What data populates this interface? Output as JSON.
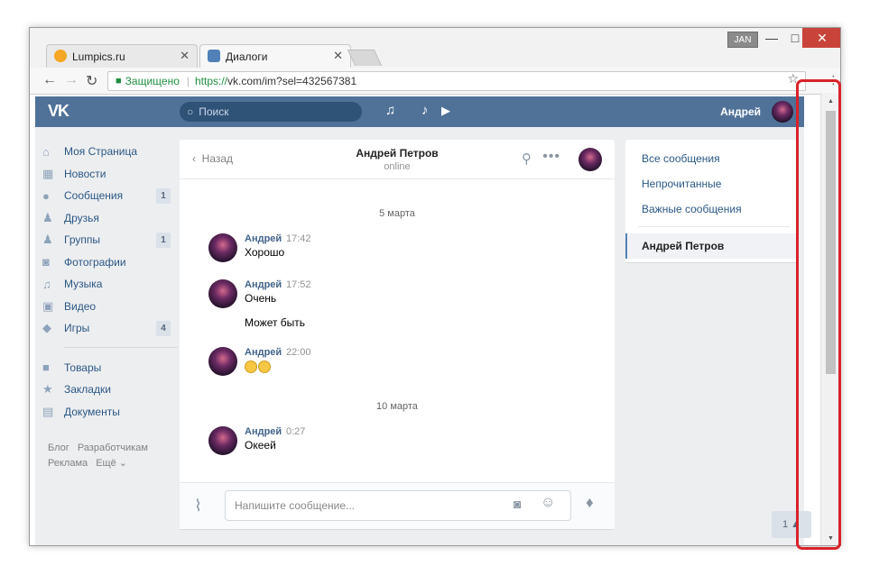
{
  "browser": {
    "tabs": [
      {
        "title": "Lumpics.ru",
        "favicon_color": "#f5a623"
      },
      {
        "title": "Диалоги",
        "favicon_color": "#5181b8"
      }
    ],
    "user_chip": "JAN",
    "window_buttons": {
      "minimize": "—",
      "maximize": "□",
      "close": "✕"
    },
    "nav": {
      "back": "←",
      "forward": "→",
      "reload": "↻"
    },
    "address": {
      "secure_label": "Защищено",
      "scheme": "https://",
      "rest": "vk.com/im?sel=432567381"
    },
    "star": "☆",
    "menu": "⋮"
  },
  "vk_header": {
    "logo": "VK",
    "search_placeholder": "Поиск",
    "user_name": "Андрей",
    "accent_color": "#507299"
  },
  "left_nav": {
    "items": [
      {
        "label": "Моя Страница",
        "icon": "home-icon",
        "glyph": "⌂",
        "badge": ""
      },
      {
        "label": "Новости",
        "icon": "news-icon",
        "glyph": "▦",
        "badge": ""
      },
      {
        "label": "Сообщения",
        "icon": "messages-icon",
        "glyph": "●",
        "badge": "1"
      },
      {
        "label": "Друзья",
        "icon": "friends-icon",
        "glyph": "♟",
        "badge": ""
      },
      {
        "label": "Группы",
        "icon": "groups-icon",
        "glyph": "♟",
        "badge": "1"
      },
      {
        "label": "Фотографии",
        "icon": "photos-icon",
        "glyph": "◙",
        "badge": ""
      },
      {
        "label": "Музыка",
        "icon": "music-icon",
        "glyph": "♫",
        "badge": ""
      },
      {
        "label": "Видео",
        "icon": "video-icon",
        "glyph": "▣",
        "badge": ""
      },
      {
        "label": "Игры",
        "icon": "games-icon",
        "glyph": "◆",
        "badge": "4"
      }
    ],
    "items2": [
      {
        "label": "Товары",
        "icon": "goods-icon",
        "glyph": "■"
      },
      {
        "label": "Закладки",
        "icon": "bookmarks-icon",
        "glyph": "★"
      },
      {
        "label": "Документы",
        "icon": "documents-icon",
        "glyph": "▤"
      }
    ],
    "footer": {
      "blog": "Блог",
      "dev": "Разработчикам",
      "ads": "Реклама",
      "more": "Ещё ⌄"
    }
  },
  "chat": {
    "back_label": "Назад",
    "peer_name": "Андрей Петров",
    "peer_status": "online",
    "dates": [
      "5 марта",
      "10 марта"
    ],
    "messages": [
      {
        "author": "Андрей",
        "time": "17:42",
        "lines": [
          "Хорошо"
        ]
      },
      {
        "author": "Андрей",
        "time": "17:52",
        "lines": [
          "Очень",
          "Может быть"
        ]
      },
      {
        "author": "Андрей",
        "time": "22:00",
        "lines": []
      },
      {
        "author": "Андрей",
        "time": "0:27",
        "lines": [
          "Океей"
        ]
      }
    ],
    "input_placeholder": "Напишите сообщение..."
  },
  "right_panel": {
    "all": "Все сообщения",
    "unread": "Непрочитанные",
    "important": "Важные сообщения",
    "active_dialog": "Андрей Петров"
  },
  "pager": "1 ▲"
}
